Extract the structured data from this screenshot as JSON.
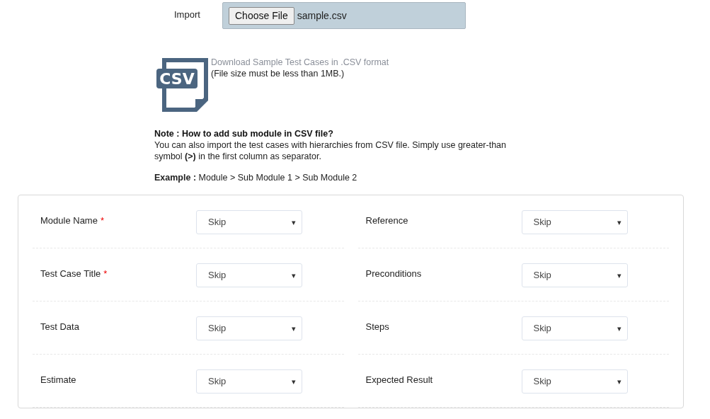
{
  "import": {
    "label": "Import",
    "button": "Choose File",
    "file_name": "sample.csv"
  },
  "download": {
    "icon_text": "CSV",
    "link": "Download Sample Test Cases in .CSV format",
    "note": "(File size must be less than 1MB.)"
  },
  "note": {
    "title": "Note : How to add sub module in CSV file?",
    "text": "You can also import the test cases with hierarchies from CSV file. Simply use greater-than symbol **(>)** in the first column as separator.",
    "example": "**Example :** Module > Sub Module 1 > Sub Module 2"
  },
  "fields": [
    {
      "label": "Module Name",
      "required": true,
      "value": "Skip",
      "arrow": "▾"
    },
    {
      "label": "Reference",
      "required": false,
      "value": "Skip",
      "arrow": "▾"
    },
    {
      "label": "Test Case Title",
      "required": true,
      "value": "Skip",
      "arrow": "▾"
    },
    {
      "label": "Preconditions",
      "required": false,
      "value": "Skip",
      "arrow": "▾"
    },
    {
      "label": "Test Data",
      "required": false,
      "value": "Skip",
      "arrow": "▾"
    },
    {
      "label": "Steps",
      "required": false,
      "value": "Skip",
      "arrow": "▾"
    },
    {
      "label": "Estimate",
      "required": false,
      "value": "Skip",
      "arrow": "▾"
    },
    {
      "label": "Expected Result",
      "required": false,
      "value": "Skip",
      "arrow": "▾"
    }
  ],
  "required_mark": "*"
}
